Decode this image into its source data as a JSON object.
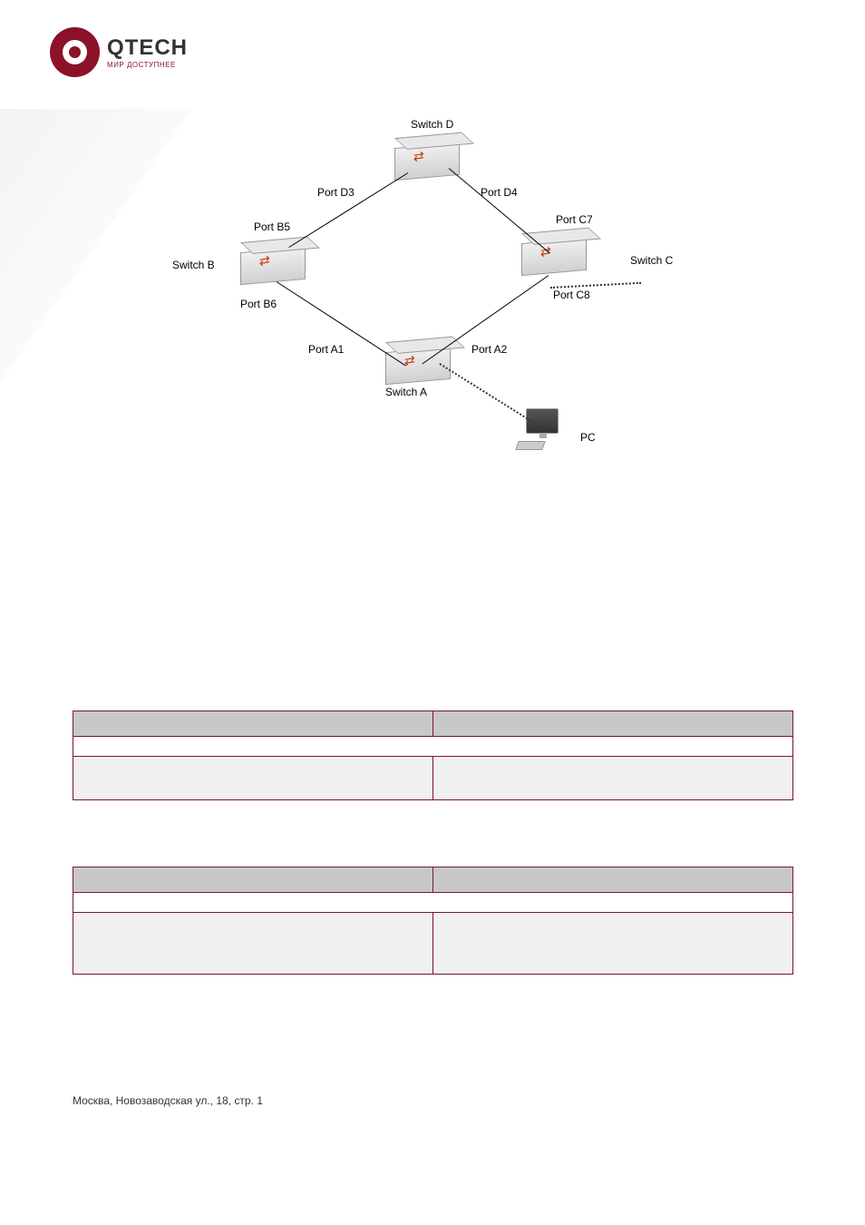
{
  "logo": {
    "main": "QTECH",
    "sub": "МИР ДОСТУПНЕЕ"
  },
  "diagram": {
    "labels": {
      "switch_d": "Switch D",
      "port_d3": "Port D3",
      "port_d4": "Port D4",
      "port_b5": "Port B5",
      "port_c7": "Port C7",
      "switch_b": "Switch B",
      "switch_c": "Switch C",
      "port_b6": "Port B6",
      "port_c8": "Port C8",
      "port_a1": "Port A1",
      "port_a2": "Port A2",
      "switch_a": "Switch A",
      "pc": "PC"
    }
  },
  "table1": {
    "h1": " ",
    "h2": " ",
    "span_row": " ",
    "cell_a": " ",
    "cell_b": " "
  },
  "table2": {
    "h1": " ",
    "h2": " ",
    "span_row": " ",
    "cell_a": " ",
    "cell_b": " "
  },
  "footer": "Москва, Новозаводская ул., 18, стр. 1"
}
